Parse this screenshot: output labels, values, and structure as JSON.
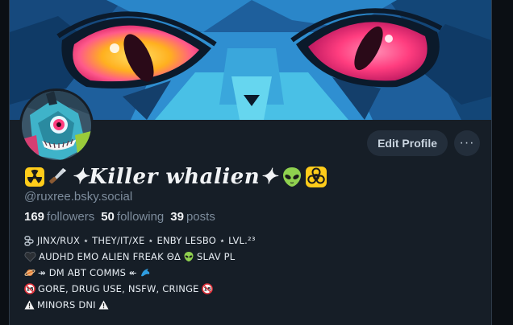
{
  "profile": {
    "display_name": "Killer whalien",
    "name_sparkle": "✦",
    "handle": "@ruxree.bsky.social",
    "stats": {
      "followers_count": "169",
      "followers_label": "followers",
      "following_count": "50",
      "following_label": "following",
      "posts_count": "39",
      "posts_label": "posts"
    },
    "actions": {
      "edit_label": "Edit Profile",
      "more_label": "···"
    },
    "bio": {
      "line1": "JINX/RUX ⋆ THEY/IT/XE ⋆ ENBY LESBO ⋆ LVL.²³",
      "line2": "AUDHD EMO ALIEN FREAK ΘΔ",
      "line2_tail": "SLAV PL",
      "line3": "↠ DM ABT COMMS ↞",
      "line4": "GORE, DRUG USE, NSFW, CRINGE",
      "line5": "MINORS DNI"
    }
  },
  "icons": {
    "name_prefix": [
      "radioactive-icon",
      "knife-icon"
    ],
    "name_suffix": [
      "alien-icon",
      "biohazard-icon"
    ],
    "bio": [
      "chains-icon",
      "black-heart-icon",
      "alien-icon",
      "ringed-planet-icon",
      "dolphin-icon",
      "no-under-18-icon",
      "warning-icon"
    ]
  },
  "colors": {
    "page_bg": "#0b0f14",
    "panel_bg": "#161e27",
    "button_bg": "#232e3b",
    "text_primary": "#f1f3f5",
    "text_muted": "#7d8c9c",
    "banner_blue": "#1a6fb0",
    "eye_pink": "#ff3d7f",
    "eye_yellow": "#ffc21a"
  }
}
